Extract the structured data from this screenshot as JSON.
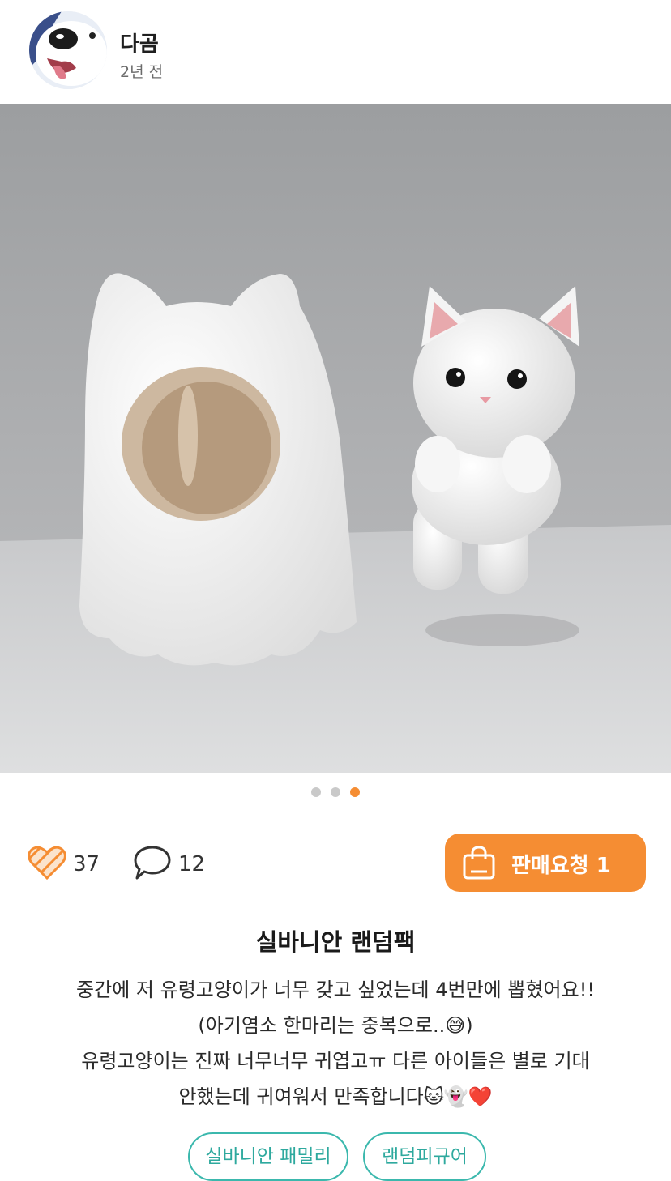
{
  "author": {
    "name": "다곰",
    "time": "2년 전"
  },
  "photo": {
    "slide_count": 3,
    "active_slide": 3
  },
  "actions": {
    "like_count": "37",
    "comment_count": "12",
    "sale_request_label": "판매요청 1"
  },
  "post": {
    "title": "실바니안 랜덤팩",
    "lines": [
      "중간에 저 유령고양이가 너무 갖고 싶었는데 4번만에 뽑혔어요!!",
      "(아기염소 한마리는 중복으로..😅)",
      "유령고양이는 진짜 너무너무 귀엽고ㅠ 다른 아이들은 별로 기대",
      "안했는데 귀여워서 만족합니다🐱👻❤️"
    ]
  },
  "tags": [
    "실바니안 패밀리",
    "랜덤피규어"
  ],
  "colors": {
    "accent": "#f58d33",
    "tag": "#3bb8ad"
  },
  "icons": [
    "heart-icon",
    "comment-icon",
    "shopping-bag-icon"
  ]
}
